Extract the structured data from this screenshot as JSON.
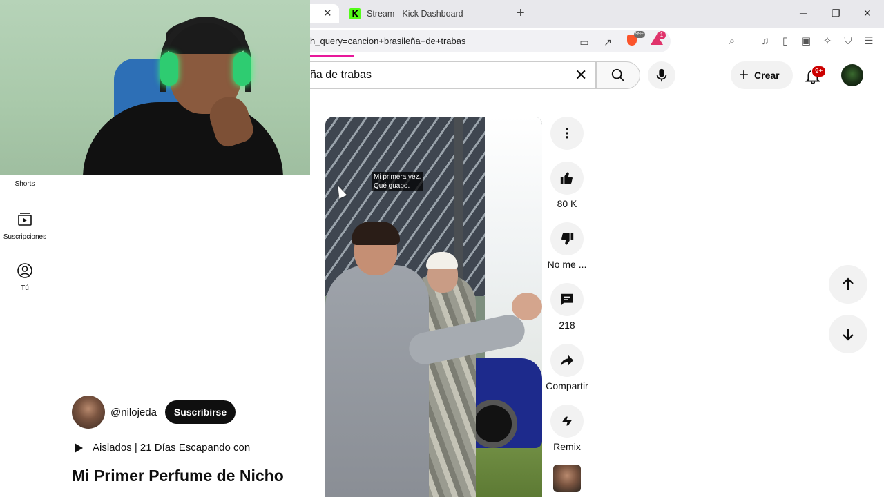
{
  "browser": {
    "tabs": [
      {
        "label": "Stream - Kick Dashboard",
        "logo_letter": "K"
      }
    ],
    "url": "h_query=cancion+brasileña+de+trabas",
    "extension_badge": "99+",
    "rewards_badge": "1"
  },
  "youtube": {
    "search_query": "ña de trabas",
    "create_label": "Crear",
    "notifications_badge": "9+"
  },
  "sidebar": {
    "items": [
      {
        "label": "Shorts"
      },
      {
        "label": "Suscripciones"
      },
      {
        "label": "Tú"
      }
    ]
  },
  "short": {
    "caption_line1": "Mi primera vez.",
    "caption_line2": "Qué guapo.",
    "channel_handle": "@nilojeda",
    "subscribe_label": "Suscribirse",
    "playlist": "Aislados | 21 Días Escapando con",
    "title": "Mi Primer Perfume de Nicho"
  },
  "actions": {
    "likes": "80 K",
    "dislike_label": "No me ...",
    "comments": "218",
    "share_label": "Compartir",
    "remix_label": "Remix"
  },
  "colors": {
    "accent_progress": "#e8189b",
    "kick_green": "#53fc18",
    "headset_glow": "#2ecc71",
    "badge_red": "#cc0000"
  }
}
